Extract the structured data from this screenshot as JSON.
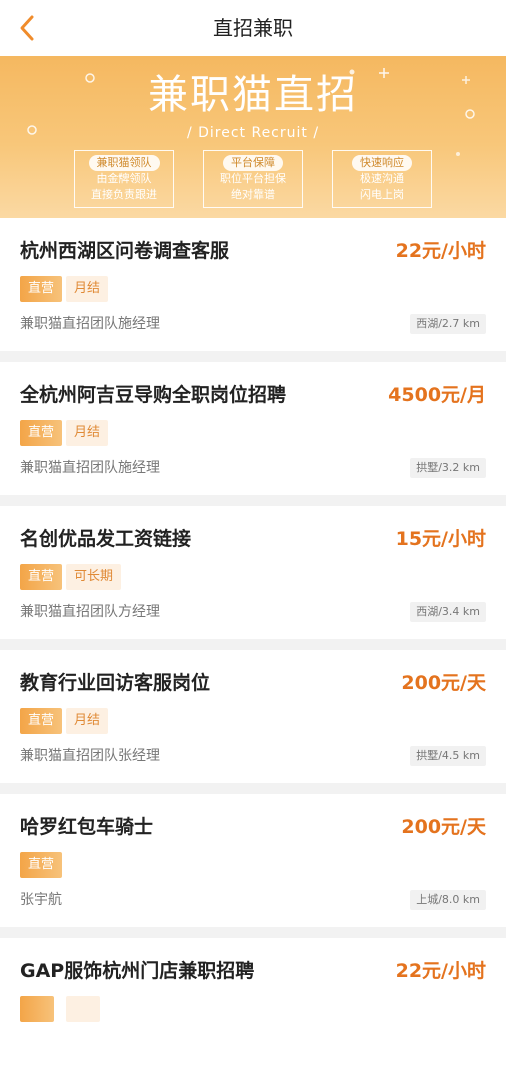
{
  "header": {
    "title": "直招兼职"
  },
  "banner": {
    "title": "兼职猫直招",
    "subtitle": "/ Direct Recruit /",
    "features": [
      {
        "head": "兼职猫领队",
        "line1": "由金牌领队",
        "line2": "直接负责跟进"
      },
      {
        "head": "平台保障",
        "line1": "职位平台担保",
        "line2": "绝对靠谱"
      },
      {
        "head": "快速响应",
        "line1": "极速沟通",
        "line2": "闪电上岗"
      }
    ]
  },
  "jobs": [
    {
      "title": "杭州西湖区问卷调查客服",
      "salary": "22元/小时",
      "tag1": "直营",
      "tag2": "月结",
      "company": "兼职猫直招团队施经理",
      "location": "西湖/2.7 km"
    },
    {
      "title": "全杭州阿吉豆导购全职岗位招聘",
      "salary": "4500元/月",
      "tag1": "直营",
      "tag2": "月结",
      "company": "兼职猫直招团队施经理",
      "location": "拱墅/3.2 km"
    },
    {
      "title": "名创优品发工资链接",
      "salary": "15元/小时",
      "tag1": "直营",
      "tag2": "可长期",
      "company": "兼职猫直招团队方经理",
      "location": "西湖/3.4 km"
    },
    {
      "title": "教育行业回访客服岗位",
      "salary": "200元/天",
      "tag1": "直营",
      "tag2": "月结",
      "company": "兼职猫直招团队张经理",
      "location": "拱墅/4.5 km"
    },
    {
      "title": "哈罗红包车骑士",
      "salary": "200元/天",
      "tag1": "直营",
      "company": "张宇航",
      "location": "上城/8.0 km"
    },
    {
      "title": "GAP服饰杭州门店兼职招聘",
      "salary": "22元/小时",
      "tag1": "",
      "tag2": ""
    }
  ]
}
